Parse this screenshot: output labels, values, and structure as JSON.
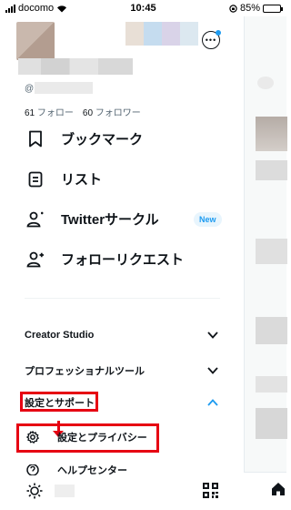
{
  "status_bar": {
    "carrier": "docomo",
    "time": "10:45",
    "battery": "85%",
    "battery_level": 0.85
  },
  "profile": {
    "handle_prefix": "@",
    "following_count": "61",
    "following_label": "フォロー",
    "followers_count": "60",
    "followers_label": "フォロワー"
  },
  "menu": {
    "bookmarks": "ブックマーク",
    "lists": "リスト",
    "circle": "Twitterサークル",
    "circle_badge": "New",
    "follow_requests": "フォローリクエスト"
  },
  "sections": {
    "creator_studio": "Creator Studio",
    "professional_tools": "プロフェッショナルツール",
    "settings_support": "設定とサポート"
  },
  "sub_items": {
    "settings_privacy": "設定とプライバシー",
    "help_center": "ヘルプセンター"
  },
  "colors": {
    "accent": "#1d9bf0",
    "annotation": "#e60012",
    "text": "#0f1419",
    "muted": "#536471"
  }
}
